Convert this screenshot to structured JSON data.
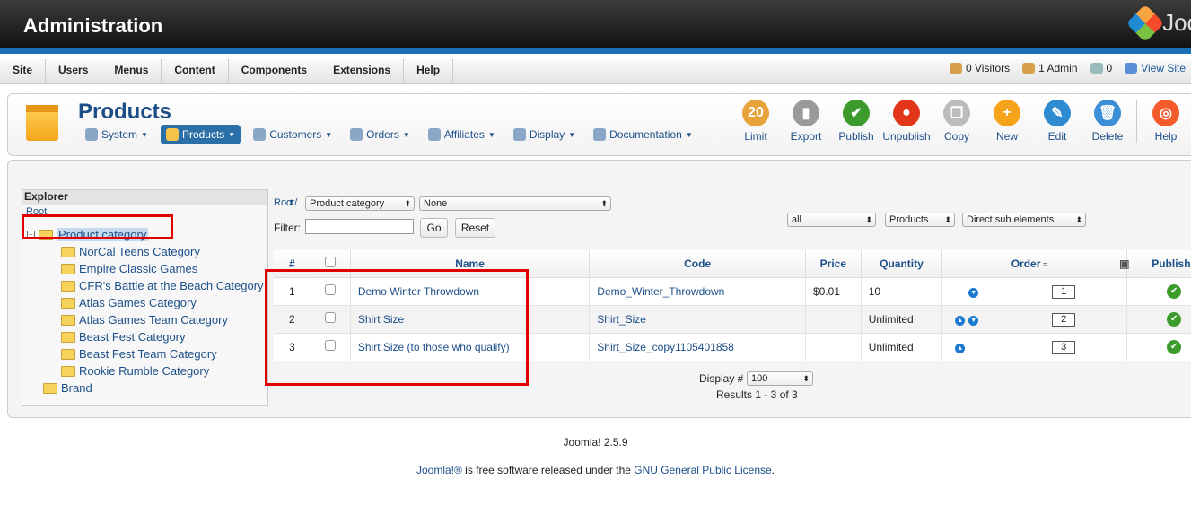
{
  "header": {
    "title": "Administration",
    "logo_text": "Joo"
  },
  "menu": {
    "items": [
      "Site",
      "Users",
      "Menus",
      "Content",
      "Components",
      "Extensions",
      "Help"
    ],
    "status": {
      "visitors": "0 Visitors",
      "admins": "1 Admin",
      "messages": "0",
      "view_site": "View Site"
    }
  },
  "panel": {
    "title": "Products",
    "subnav": [
      {
        "label": "System",
        "icon": "wrench-icon"
      },
      {
        "label": "Products",
        "icon": "box-icon",
        "active": true
      },
      {
        "label": "Customers",
        "icon": "users-icon"
      },
      {
        "label": "Orders",
        "icon": "orders-icon"
      },
      {
        "label": "Affiliates",
        "icon": "affiliates-icon"
      },
      {
        "label": "Display",
        "icon": "display-icon"
      },
      {
        "label": "Documentation",
        "icon": "lifebuoy-icon"
      }
    ],
    "toolbar": [
      {
        "label": "Limit",
        "color": "#e8a23a",
        "glyph": "20"
      },
      {
        "label": "Export",
        "color": "#9a9a9a",
        "glyph": "▮"
      },
      {
        "label": "Publish",
        "color": "#3d9b2c",
        "glyph": "✔"
      },
      {
        "label": "Unpublish",
        "color": "#e2361b",
        "glyph": "●"
      },
      {
        "label": "Copy",
        "color": "#bcbcbc",
        "glyph": "❐"
      },
      {
        "label": "New",
        "color": "#f6a21a",
        "glyph": "+"
      },
      {
        "label": "Edit",
        "color": "#2e8bd2",
        "glyph": "✎"
      },
      {
        "label": "Delete",
        "color": "#3a8fd6",
        "glyph": "🗑"
      },
      {
        "label": "Help",
        "color": "#f35b2a",
        "glyph": "◎"
      }
    ]
  },
  "explorer": {
    "title": "Explorer",
    "root": "Root",
    "tree": [
      "Product category",
      "NorCal Teens Category",
      "Empire Classic Games",
      "CFR's Battle at the Beach Category",
      "Atlas Games Category",
      "Atlas Games Team Category",
      "Beast Fest Category",
      "Beast Fest Team Category",
      "Rookie Rumble Category",
      "Brand"
    ]
  },
  "filters": {
    "root_link": "Root/",
    "category_select": "Product category",
    "none_select": "None",
    "filter_label": "Filter:",
    "go": "Go",
    "reset": "Reset",
    "all_select": "all",
    "products_select": "Products",
    "sub_select": "Direct sub elements"
  },
  "table": {
    "headers": [
      "#",
      "",
      "Name",
      "Code",
      "Price",
      "Quantity",
      "Order",
      "",
      "Publishe"
    ],
    "rows": [
      {
        "num": "1",
        "name": "Demo Winter Throwdown",
        "code": "Demo_Winter_Throwdown",
        "price": "$0.01",
        "qty": "10",
        "order": "1",
        "up": false,
        "down": true
      },
      {
        "num": "2",
        "name": "Shirt Size",
        "code": "Shirt_Size",
        "price": "",
        "qty": "Unlimited",
        "order": "2",
        "up": true,
        "down": true
      },
      {
        "num": "3",
        "name": "Shirt Size (to those who qualify)",
        "code": "Shirt_Size_copy1105401858",
        "price": "",
        "qty": "Unlimited",
        "order": "3",
        "up": true,
        "down": false
      }
    ]
  },
  "pagination": {
    "display_label": "Display #",
    "display_value": "100",
    "results": "Results 1 - 3 of 3"
  },
  "footer": {
    "version": "Joomla! 2.5.9",
    "license_prefix": "Joomla!®",
    "license_mid": " is free software released under the ",
    "license_link": "GNU General Public License",
    "license_end": "."
  }
}
